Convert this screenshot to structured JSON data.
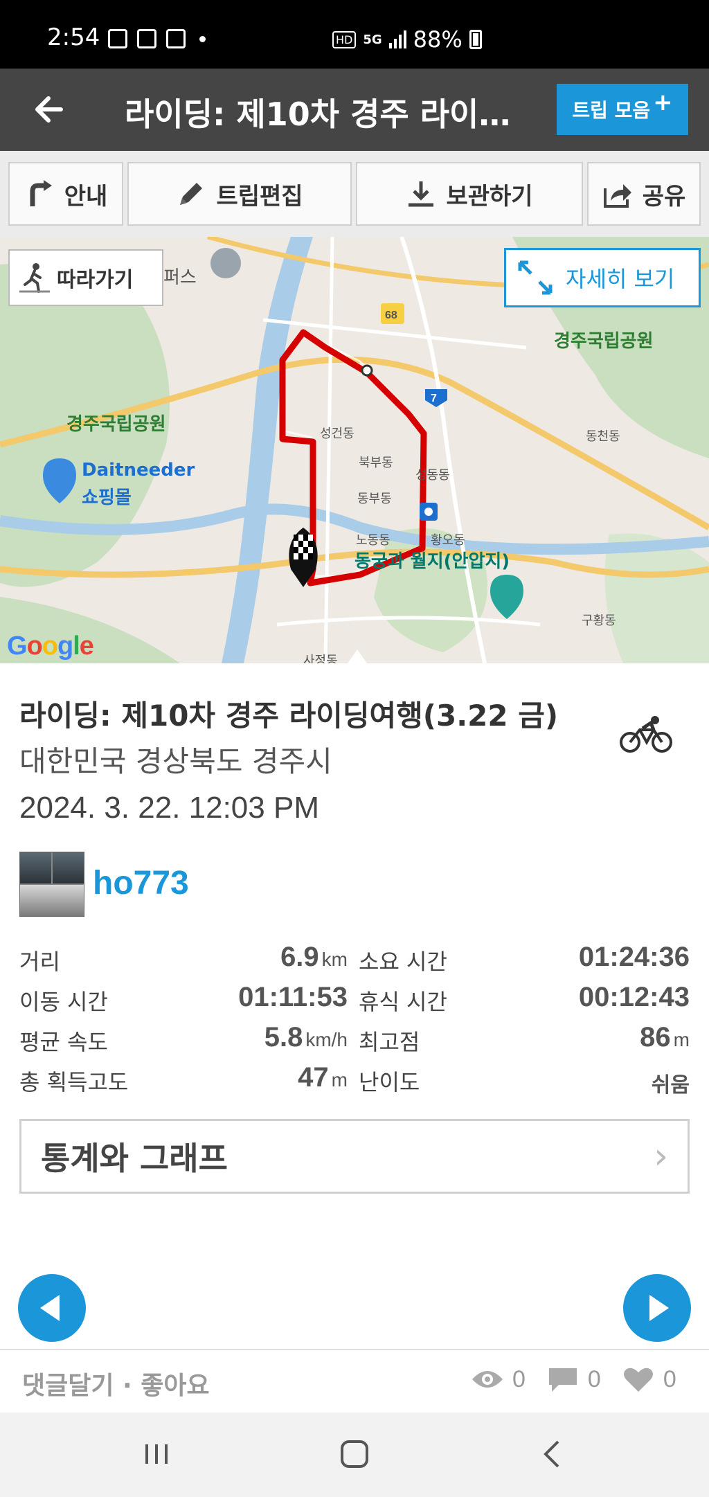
{
  "status_bar": {
    "time": "2:54",
    "battery": "88%",
    "network": "5G",
    "hd": "HD"
  },
  "header": {
    "title": "라이딩: 제10차 경주 라이...",
    "trip_collection_label": "트립 모음",
    "trip_collection_plus": "+"
  },
  "toolbar": {
    "guide_label": "안내",
    "edit_label": "트립편집",
    "save_label": "보관하기",
    "share_label": "공유"
  },
  "map": {
    "follow_label": "따라가기",
    "detail_label": "자세히 보기",
    "google": "Google",
    "labels": {
      "park_left": "경주국립공원",
      "park_right": "경주국립공원",
      "mall_name": "Daitneeder",
      "mall_sub": "쇼핑몰",
      "pond": "동궁과 월지(안압지)",
      "route_68": "68",
      "route_7": "7",
      "dong_1": "성건동",
      "dong_2": "북부동",
      "dong_3": "동부동",
      "dong_4": "성동동",
      "dong_5": "노동동",
      "dong_6": "황오동",
      "dong_7": "동천동",
      "dong_8": "구황동",
      "dong_9": "사정동",
      "campus": "퍼스"
    }
  },
  "trip": {
    "title": "라이딩: 제10차 경주 라이딩여행(3.22 금)",
    "location": "대한민국 경상북도 경주시",
    "datetime": "2024. 3. 22. 12:03 PM",
    "username": "ho773"
  },
  "stats": {
    "distance_label": "거리",
    "distance_value": "6.9",
    "distance_unit": "km",
    "duration_label": "소요 시간",
    "duration_value": "01:24:36",
    "moving_label": "이동 시간",
    "moving_value": "01:11:53",
    "rest_label": "휴식 시간",
    "rest_value": "00:12:43",
    "avg_speed_label": "평균 속도",
    "avg_speed_value": "5.8",
    "avg_speed_unit": "km/h",
    "max_elev_label": "최고점",
    "max_elev_value": "86",
    "max_elev_unit": "m",
    "total_gain_label": "총 획득고도",
    "total_gain_value": "47",
    "total_gain_unit": "m",
    "difficulty_label": "난이도",
    "difficulty_value": "쉬움"
  },
  "graph_button": {
    "label": "통계와 그래프",
    "chevron": "›"
  },
  "comment_bar": {
    "actions": "댓글달기 · 좋아요",
    "views": "0",
    "comments": "0",
    "likes": "0"
  },
  "colors": {
    "accent": "#1b96d8",
    "header_bg": "#454545",
    "route": "#d50000"
  }
}
